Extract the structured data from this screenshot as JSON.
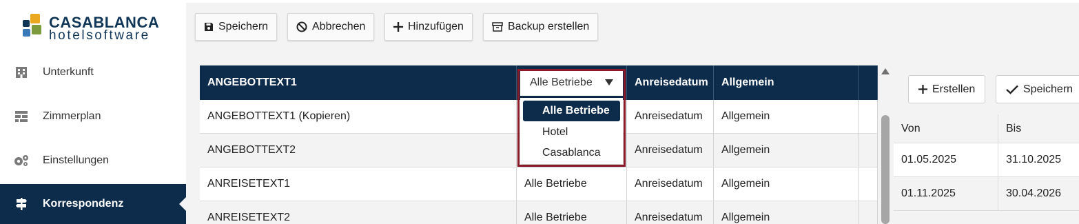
{
  "brand": {
    "name": "CASABLANCA",
    "tagline": "hotelsoftware",
    "colors": [
      "#0f3557",
      "#e9a820",
      "#7d9a3c",
      "#3a78b8"
    ]
  },
  "sidebar": {
    "items": [
      {
        "label": "Unterkunft",
        "icon": "building-icon",
        "active": false
      },
      {
        "label": "Zimmerplan",
        "icon": "room-plan-icon",
        "active": false
      },
      {
        "label": "Einstellungen",
        "icon": "gears-icon",
        "active": false
      },
      {
        "label": "Korrespondenz",
        "icon": "signpost-icon",
        "active": true
      }
    ]
  },
  "toolbar": {
    "save_label": "Speichern",
    "cancel_label": "Abbrechen",
    "add_label": "Hinzufügen",
    "backup_label": "Backup erstellen"
  },
  "grid": {
    "header": {
      "name": "ANGEBOTTEXT1",
      "betrieb": "Alle Betriebe",
      "datum": "Anreisedatum",
      "kategorie": "Allgemein"
    },
    "rows": [
      {
        "name": "ANGEBOTTEXT1 (Kopieren)",
        "betrieb": "",
        "datum": "Anreisedatum",
        "kategorie": "Allgemein"
      },
      {
        "name": "ANGEBOTTEXT2",
        "betrieb": "",
        "datum": "Anreisedatum",
        "kategorie": "Allgemein"
      },
      {
        "name": "ANREISETEXT1",
        "betrieb": "Alle Betriebe",
        "datum": "Anreisedatum",
        "kategorie": "Allgemein"
      },
      {
        "name": "ANREISETEXT2",
        "betrieb": "Alle Betriebe",
        "datum": "Anreisedatum",
        "kategorie": "Allgemein"
      }
    ]
  },
  "dropdown": {
    "selected": "Alle Betriebe",
    "options": [
      "Alle Betriebe",
      "Hotel",
      "Casablanca"
    ]
  },
  "right_panel": {
    "create_label": "Erstellen",
    "save_label": "Speichern",
    "columns": [
      "Von",
      "Bis"
    ],
    "rows": [
      {
        "von": "01.05.2025",
        "bis": "31.10.2025"
      },
      {
        "von": "01.11.2025",
        "bis": "30.04.2026"
      }
    ]
  },
  "colors": {
    "navy": "#0d2b4a",
    "highlight": "#8b1a2b",
    "panel_bg": "#f3f3f3"
  }
}
